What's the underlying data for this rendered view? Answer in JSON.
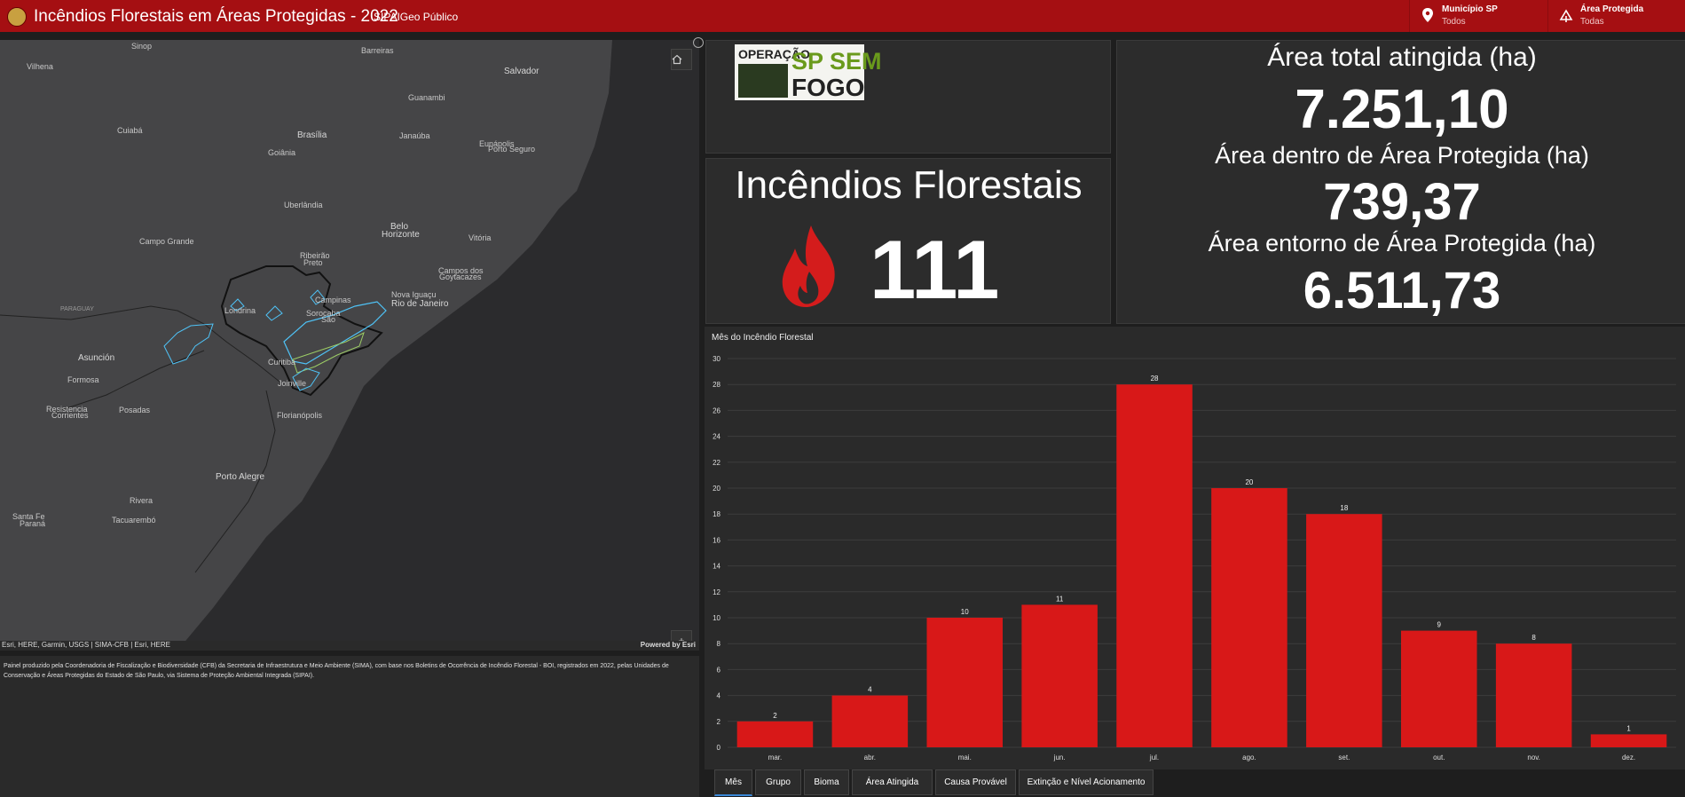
{
  "header": {
    "title": "Incêndios Florestais em Áreas Protegidas - 2022",
    "subtitle": "SIPAIGeo Público",
    "filters": [
      {
        "label": "Município SP",
        "value": "Todos"
      },
      {
        "label": "Área Protegida",
        "value": "Todas"
      }
    ]
  },
  "map": {
    "cities": [
      "Sinop",
      "Vilhena",
      "Barreiras",
      "Salvador",
      "Guanambi",
      "Cuiabá",
      "Brasília",
      "Janaúba",
      "Eunápolis",
      "Porto Seguro",
      "Goiânia",
      "Uberlândia",
      "Belo",
      "Horizonte",
      "Vitória",
      "Campo Grande",
      "Ribeirão",
      "Preto",
      "Campos dos",
      "Goytacazes",
      "PARAGUAY",
      "Londrina",
      "Campinas",
      "Nova Iguaçu",
      "Rio de Janeiro",
      "Sorocaba",
      "São",
      "Asunción",
      "Curitiba",
      "Formosa",
      "Joinville",
      "Resistencia",
      "Corrientes",
      "Posadas",
      "Florianópolis",
      "Porto Alegre",
      "Rivera",
      "Santa Fe",
      "Paraná",
      "Tacuarembó"
    ],
    "attribution_left": "Esri, HERE, Garmin, USGS | SIMA-CFB | Esri, HERE",
    "attribution_right": "Powered by Esri",
    "zoom_in": "+",
    "zoom_out": "−"
  },
  "note": "Painel produzido pela Coordenadoria de Fiscalização e Biodiversidade (CFB) da Secretaria de Infraestrutura e Meio Ambiente (SIMA), com base nos Boletins de Ocorrência de Incêndio Florestal - BOI, registrados em 2022, pelas Unidades de Conservação e Áreas Protegidas do Estado de São Paulo, via Sistema de Proteção Ambiental Integrada (SIPAI).",
  "logo": {
    "line1": "OPERAÇÃO",
    "line2": "SP SEM",
    "line3": "FOGO"
  },
  "indicator": {
    "title": "Incêndios Florestais",
    "count": "111"
  },
  "areas": [
    {
      "label": "Área total atingida (ha)",
      "value": "7.251,10"
    },
    {
      "label": "Área dentro de Área Protegida (ha)",
      "value": "739,37"
    },
    {
      "label": "Área entorno de Área Protegida (ha)",
      "value": "6.511,73"
    }
  ],
  "chart_data": {
    "type": "bar",
    "title": "Mês do  Incêndio Florestal",
    "categories": [
      "mar.",
      "abr.",
      "mai.",
      "jun.",
      "jul.",
      "ago.",
      "set.",
      "out.",
      "nov.",
      "dez."
    ],
    "values": [
      2,
      4,
      10,
      11,
      28,
      20,
      18,
      9,
      8,
      1
    ],
    "ylim": [
      0,
      30
    ],
    "yticks": [
      0,
      2,
      4,
      6,
      8,
      10,
      12,
      14,
      16,
      18,
      20,
      22,
      24,
      26,
      28,
      30
    ],
    "color": "#d81818",
    "grid": true
  },
  "tabs": [
    "Mês",
    "Grupo",
    "Bioma",
    "Área Atingida",
    "Causa Provável",
    "Extinção e Nível Acionamento"
  ],
  "colors": {
    "header": "#a50f12",
    "accent": "#3a87d6",
    "bar": "#d81818",
    "fire": "#d41c1c"
  }
}
